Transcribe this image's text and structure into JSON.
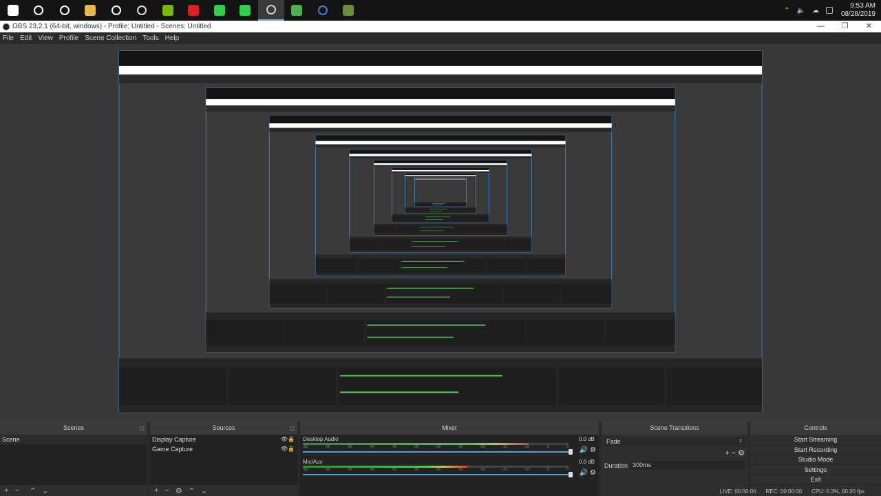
{
  "taskbar": {
    "icons": [
      {
        "name": "windows-start-icon",
        "color": "#ffffff"
      },
      {
        "name": "search-icon",
        "color": "#ffffff"
      },
      {
        "name": "task-view-icon",
        "color": "#ffffff"
      },
      {
        "name": "file-explorer-icon",
        "color": "#e8b84a"
      },
      {
        "name": "settings-gear-icon",
        "color": "#ffffff"
      },
      {
        "name": "satellite-app-icon",
        "color": "#dddddd"
      },
      {
        "name": "nvidia-icon",
        "color": "#76b900"
      },
      {
        "name": "bitdefender-icon",
        "color": "#e02020"
      },
      {
        "name": "razer-cortex-icon",
        "color": "#2fd14b"
      },
      {
        "name": "razer-synapse-icon",
        "color": "#2fd14b"
      },
      {
        "name": "obs-icon",
        "color": "#cfcfcf"
      },
      {
        "name": "chrome-icon",
        "color": "#4caf50"
      },
      {
        "name": "network-app-icon",
        "color": "#4a7fd8"
      },
      {
        "name": "minecraft-icon",
        "color": "#6b8e3a"
      }
    ],
    "active_index": 10,
    "clock": {
      "time": "9:53 AM",
      "date": "08/28/2019"
    }
  },
  "window": {
    "title": "OBS 23.2.1 (64-bit, windows) - Profile: Untitled - Scenes: Untitled",
    "controls": [
      "—",
      "❐",
      "✕"
    ]
  },
  "menu": [
    "File",
    "Edit",
    "View",
    "Profile",
    "Scene Collection",
    "Tools",
    "Help"
  ],
  "scenes": {
    "title": "Scenes",
    "items": [
      "Scene"
    ]
  },
  "sources": {
    "title": "Sources",
    "items": [
      "Display Capture",
      "Game Capture"
    ]
  },
  "mixer": {
    "title": "Mixer",
    "tracks": [
      {
        "name": "Desktop Audio",
        "db": "0.0 dB",
        "level": 0.85
      },
      {
        "name": "Mic/Aux",
        "db": "0.0 dB",
        "level": 0.62
      }
    ],
    "scale": [
      "-60",
      "-55",
      "-50",
      "-45",
      "-40",
      "-35",
      "-30",
      "-25",
      "-20",
      "-15",
      "-10",
      "-5",
      "0"
    ]
  },
  "transitions": {
    "title": "Scene Transitions",
    "selected": "Fade",
    "duration_label": "Duration",
    "duration": "300ms"
  },
  "controls": {
    "title": "Controls",
    "buttons": [
      "Start Streaming",
      "Start Recording",
      "Studio Mode",
      "Settings",
      "Exit"
    ]
  },
  "status": {
    "live": "LIVE: 00:00:00",
    "rec": "REC: 00:00:00",
    "cpu": "CPU: 0.3%, 60.00 fps"
  },
  "colors": {
    "accent": "#4aa3df",
    "meter_green": "#56c456",
    "recursive_border": "#3f7fbf"
  }
}
